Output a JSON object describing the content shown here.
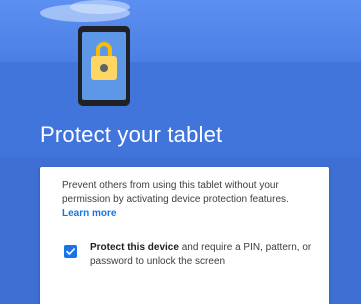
{
  "title": "Protect your tablet",
  "description": {
    "text": "Prevent others from using this tablet without your permission by activating device protection features. ",
    "link": "Learn more"
  },
  "protect_option": {
    "checked": true,
    "bold_label": "Protect this device",
    "rest_label": " and require a PIN, pattern, or password to unlock the screen"
  },
  "colors": {
    "background": "#3f6fd3",
    "accent": "#1a73e8",
    "lock": "#fbbc04"
  },
  "icons": [
    "tablet-lock-illustration",
    "lock-icon",
    "checkbox-checked-icon"
  ]
}
